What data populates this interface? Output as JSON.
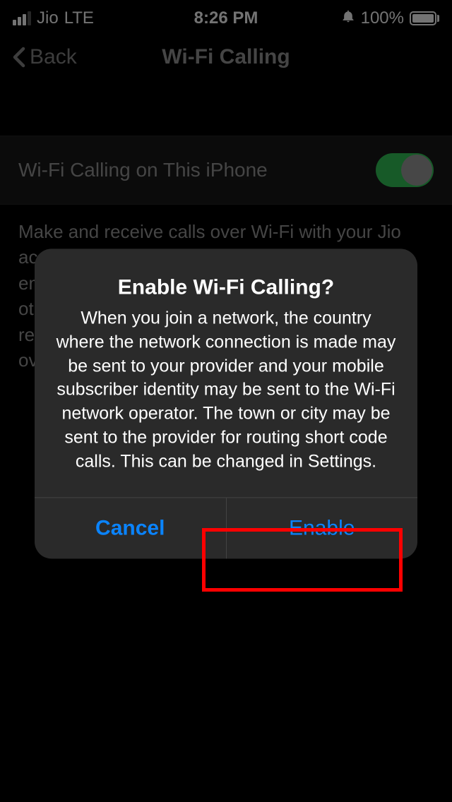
{
  "statusBar": {
    "carrier": "Jio",
    "networkType": "LTE",
    "time": "8:26 PM",
    "batteryPercent": "100%"
  },
  "nav": {
    "backLabel": "Back",
    "title": "Wi-Fi Calling"
  },
  "toggleRow": {
    "label": "Wi-Fi Calling on This iPhone"
  },
  "description": {
    "text": "Make and receive calls over Wi-Fi with your Jio account. When cellular service is available, for emergency calls your iPhone will use its location; otherwise the last address entered is used to aid response efforts if you call emergency services over Wi-Fi.",
    "linkStart": "A"
  },
  "alert": {
    "title": "Enable Wi-Fi Calling?",
    "message": "When you join a network, the country where the network connection is made may be sent to your provider and your mobile subscriber identity may be sent to the Wi-Fi network operator. The town or city may be sent to the provider for routing short code calls. This can be changed in Settings.",
    "cancelLabel": "Cancel",
    "enableLabel": "Enable"
  }
}
